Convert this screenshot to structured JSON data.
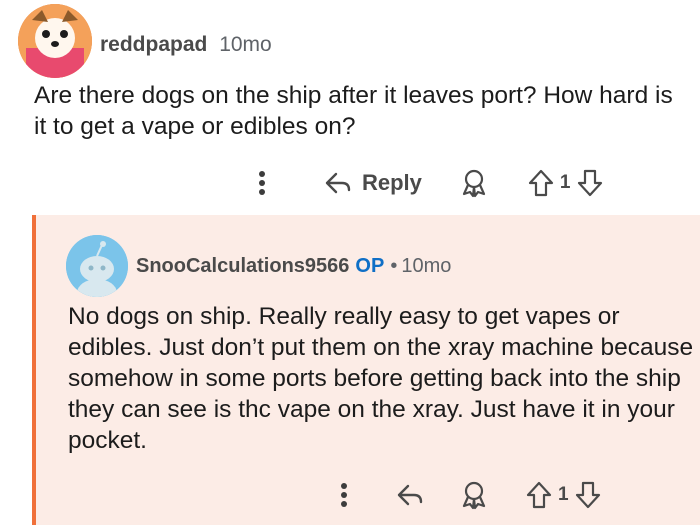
{
  "parent_comment": {
    "username": "reddpapad",
    "time": "10mo",
    "body": "Are there dogs on the ship after it leaves port? How hard is it to get a vape or edibles on?",
    "actions": {
      "reply_label": "Reply",
      "vote_count": "1"
    }
  },
  "reply_comment": {
    "username": "SnooCalculations9566",
    "op_badge": "OP",
    "separator": "•",
    "time": "10mo",
    "body": "No dogs on ship. Really really easy to get vapes or edibles. Just don’t put them on the xray machine because somehow in some ports before getting back into the ship they can see is thc vape on the xray. Just have it in your pocket.",
    "actions": {
      "vote_count": "1"
    }
  },
  "colors": {
    "accent_border": "#f0703a",
    "reply_background": "#fcece6",
    "op_badge": "#0f6fc6"
  },
  "icons": [
    "more-options-icon",
    "reply-icon",
    "award-icon",
    "upvote-icon",
    "downvote-icon"
  ]
}
